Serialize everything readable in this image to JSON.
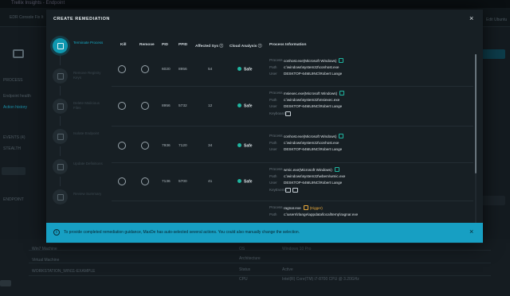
{
  "background": {
    "window_title": "Trellix Insights - Endpoint",
    "breadcrumb": "EDR Console  Fix It",
    "left_labels": [
      "PROCESS",
      "Endpoint health",
      "EVENTS (4)",
      "STEALTH",
      "ENDPOINT"
    ],
    "left_link": "Action history",
    "right_label": "Edit Ubuntu",
    "row_labels": [
      "Win7 Machine",
      "Virtual Machine",
      "WORKSTATION_WIN11-EXAMPLE"
    ],
    "right_values": [
      "Windows 10 Pro",
      "Active",
      "Intel(R) Core(TM) i7-8700 CPU @ 3.20GHz"
    ],
    "col_labels": [
      "OS",
      "Architecture",
      "Status",
      "CPU"
    ]
  },
  "modal": {
    "title": "CREATE REMEDIATION",
    "close_label": "×",
    "steps": [
      {
        "label": "Terminate Process",
        "active": true,
        "icon": "terminate-process-icon"
      },
      {
        "label": "Remove Registry Keys",
        "active": false,
        "icon": "registry-icon"
      },
      {
        "label": "Delete Malicious Files",
        "active": false,
        "icon": "file-icon"
      },
      {
        "label": "Isolate Endpoint",
        "active": false,
        "icon": "isolate-icon"
      },
      {
        "label": "Update Definitions",
        "active": false,
        "icon": "update-icon"
      },
      {
        "label": "Review Summary",
        "active": false,
        "icon": "summary-icon"
      }
    ],
    "columns": {
      "kill": "Kill",
      "remove": "Remove",
      "pid": "PID",
      "ppid": "PPID",
      "affected": "Affected Sys ⓘ",
      "cloud": "Cloud Analysis ⓘ",
      "process_info": "Process Information"
    },
    "info_keys": {
      "process": "Process",
      "path": "Path",
      "user": "User",
      "keyboards": "Keyboards",
      "keyevents": "KeyEvents"
    },
    "rows": [
      {
        "pid": "6020",
        "ppid": "8956",
        "affected": "54",
        "cloud": "Safe",
        "process": "conhost.exe(Microsoft Windows)",
        "path": "c:\\windows\\system32\\conhost.exe",
        "user": "DESKTOP-64ML9NC\\Robert Lange"
      },
      {
        "pid": "8956",
        "ppid": "5732",
        "affected": "12",
        "cloud": "Safe",
        "process": "msiexec.exe(Microsoft Windows)",
        "path": "c:\\windows\\system32\\msiexec.exe",
        "user": "DESKTOP-64ML9NC\\Robert Lange"
      },
      {
        "pid": "7936",
        "ppid": "7120",
        "affected": "34",
        "cloud": "Safe",
        "process": "conhost.exe(Microsoft Windows)",
        "path": "c:\\windows\\system32\\conhost.exe",
        "user": "DESKTOP-64ML9NC\\Robert Lange"
      },
      {
        "pid": "7136",
        "ppid": "5700",
        "affected": "41",
        "cloud": "Safe",
        "process": "wmic.exe(Microsoft Windows)",
        "path": "c:\\windows\\system32\\wbem\\wmic.exe",
        "user": "DESKTOP-64ML9NC\\Robert Lange"
      },
      {
        "process": "ragnar.exe",
        "trigger": "(trigger)",
        "path": "c:\\users\\rlange\\appdata\\local\\temp\\ragnar.exe"
      }
    ]
  },
  "banner": {
    "text": "To provide completed remediation guidance, MaxDe has auto-selected several actions. You could also manually change the selection.",
    "close_label": "×",
    "icon": "info-icon"
  },
  "colors": {
    "accent": "#0f98b0",
    "banner": "#179fc3",
    "safe": "#1fb5a0",
    "trigger": "#e9a93b"
  }
}
